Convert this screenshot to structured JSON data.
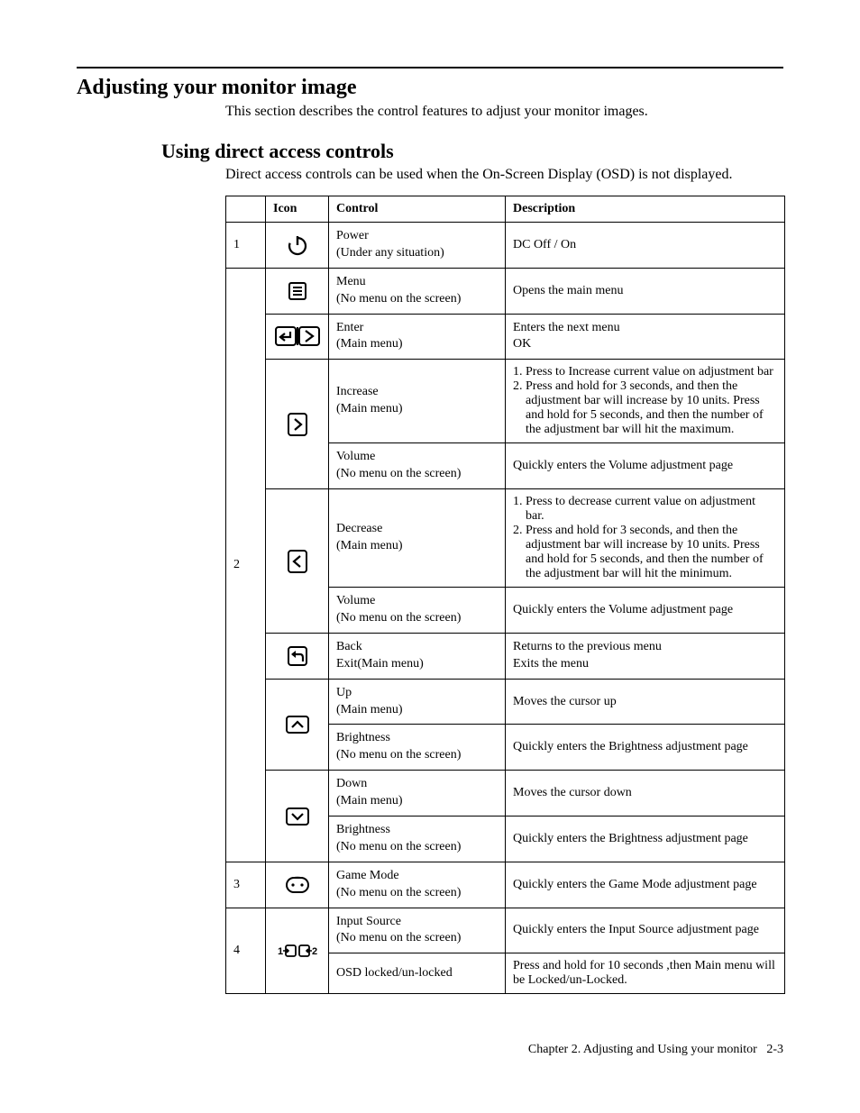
{
  "h1": "Adjusting your monitor image",
  "intro1": "This section describes the control features to adjust your monitor images.",
  "h2": "Using direct access controls",
  "intro2": "Direct access controls can be used when the On-Screen Display (OSD) is not displayed.",
  "headers": {
    "icon": "Icon",
    "control": "Control",
    "desc": "Description"
  },
  "rows": {
    "n1": "1",
    "n2": "2",
    "n3": "3",
    "n4": "4",
    "power_ctrl1": "Power",
    "power_ctrl2": "(Under any situation)",
    "power_desc": "DC Off / On",
    "menu_ctrl1": "Menu",
    "menu_ctrl2": "(No menu on the screen)",
    "menu_desc": "Opens the main menu",
    "enter_ctrl1": "Enter",
    "enter_ctrl2": "(Main menu)",
    "enter_desc1": "Enters the next menu",
    "enter_desc2": "OK",
    "inc_ctrl1": "Increase",
    "inc_ctrl2": "(Main menu)",
    "inc_desc1": "1. Press to Increase current value on adjustment bar",
    "inc_desc2": "2. Press and hold for 3 seconds, and then the adjustment bar will increase by 10 units. Press and hold for 5 seconds, and then the number of the adjustment bar will hit the maximum.",
    "vol_ctrl1": "Volume",
    "vol_ctrl2": "(No menu on the screen)",
    "vol_desc": "Quickly enters the Volume adjustment page",
    "dec_ctrl1": "Decrease",
    "dec_ctrl2": "(Main menu)",
    "dec_desc1": "1. Press to decrease current value on adjustment bar.",
    "dec_desc2": "2. Press and hold for 3 seconds, and then the adjustment bar will increase by 10 units. Press and hold for 5 seconds, and then the number of the adjustment bar will hit the minimum.",
    "back_ctrl1": "Back",
    "back_ctrl2": "Exit(Main menu)",
    "back_desc1": "Returns to the previous menu",
    "back_desc2": "Exits the menu",
    "up_ctrl1": "Up",
    "up_ctrl2": "(Main menu)",
    "up_desc": "Moves the cursor up",
    "bri_ctrl1": "Brightness",
    "bri_ctrl2": "(No menu on the screen)",
    "bri_desc": "Quickly enters the Brightness adjustment page",
    "down_ctrl1": "Down",
    "down_ctrl2": "(Main menu)",
    "down_desc": "Moves the cursor down",
    "game_ctrl1": "Game Mode",
    "game_ctrl2": "(No menu on the screen)",
    "game_desc": "Quickly enters the Game Mode adjustment page",
    "input_ctrl1": "Input Source",
    "input_ctrl2": "(No menu on the screen)",
    "input_desc": "Quickly enters the Input Source adjustment page",
    "osd_ctrl": "OSD locked/un-locked",
    "osd_desc": "Press and hold for 10 seconds ,then Main menu will be Locked/un-Locked."
  },
  "footer": {
    "chapter": "Chapter 2. Adjusting and Using your monitor",
    "page": "2-3"
  }
}
